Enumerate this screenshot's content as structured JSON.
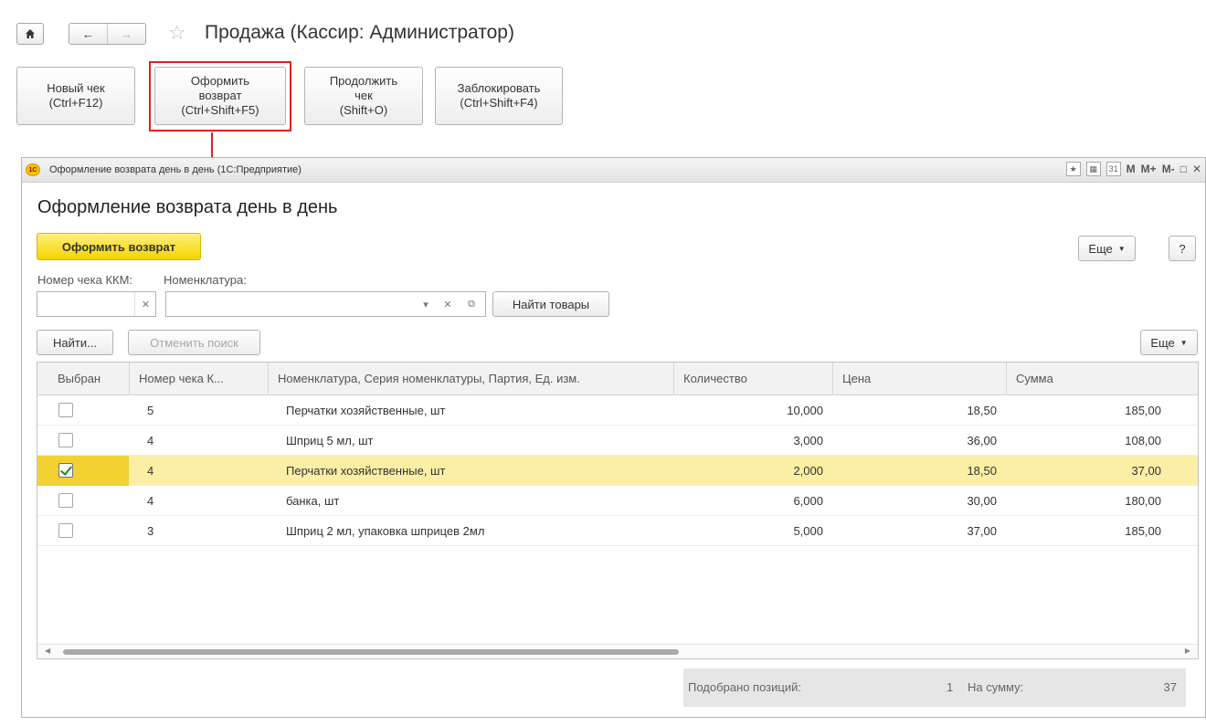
{
  "nav": {
    "home_icon": "home-icon",
    "back_glyph": "←",
    "forward_glyph": "→",
    "star_glyph": "☆"
  },
  "page": {
    "title": "Продажа (Кассир: Администратор)"
  },
  "commands": [
    {
      "label": "Новый чек\n(Ctrl+F12)"
    },
    {
      "label": "Оформить\nвозврат\n(Ctrl+Shift+F5)"
    },
    {
      "label": "Продолжить\nчек\n(Shift+O)"
    },
    {
      "label": "Заблокировать\n(Ctrl+Shift+F4)"
    }
  ],
  "window": {
    "title": "Оформление возврата день в день  (1С:Предприятие)",
    "logo": "1С",
    "tools": {
      "m": "M",
      "mplus": "M+",
      "mminus": "M-",
      "cal": "31"
    }
  },
  "form": {
    "title": "Оформление возврата день в день",
    "primary_button": "Оформить возврат",
    "more_label": "Еще",
    "help_label": "?",
    "receipt_label": "Номер чека ККМ:",
    "receipt_value": "",
    "nomenclature_label": "Номенклатура:",
    "nomenclature_value": "",
    "find_goods_label": "Найти товары",
    "find_label": "Найти...",
    "cancel_search_label": "Отменить поиск",
    "grid_more_label": "Еще"
  },
  "table": {
    "headers": [
      "Выбран",
      "Номер чека К...",
      "Номенклатура, Серия номенклатуры, Партия, Ед. изм.",
      "Количество",
      "Цена",
      "Сумма"
    ],
    "rows": [
      {
        "checked": false,
        "receipt": "5",
        "item": "Перчатки хозяйственные, шт",
        "qty": "10,000",
        "price": "18,50",
        "sum": "185,00"
      },
      {
        "checked": false,
        "receipt": "4",
        "item": "Шприц 5 мл, шт",
        "qty": "3,000",
        "price": "36,00",
        "sum": "108,00"
      },
      {
        "checked": true,
        "receipt": "4",
        "item": "Перчатки хозяйственные, шт",
        "qty": "2,000",
        "price": "18,50",
        "sum": "37,00"
      },
      {
        "checked": false,
        "receipt": "4",
        "item": "банка, шт",
        "qty": "6,000",
        "price": "30,00",
        "sum": "180,00"
      },
      {
        "checked": false,
        "receipt": "3",
        "item": "Шприц 2 мл, упаковка шприцев 2мл",
        "qty": "5,000",
        "price": "37,00",
        "sum": "185,00"
      }
    ]
  },
  "footer": {
    "selected_label": "Подобрано позиций:",
    "selected_count": "1",
    "sum_label": "На сумму:",
    "sum_value": "37"
  },
  "colors": {
    "accent_yellow": "#f4d400",
    "highlight_red": "#e02020",
    "selected_row": "#fbeea5"
  }
}
